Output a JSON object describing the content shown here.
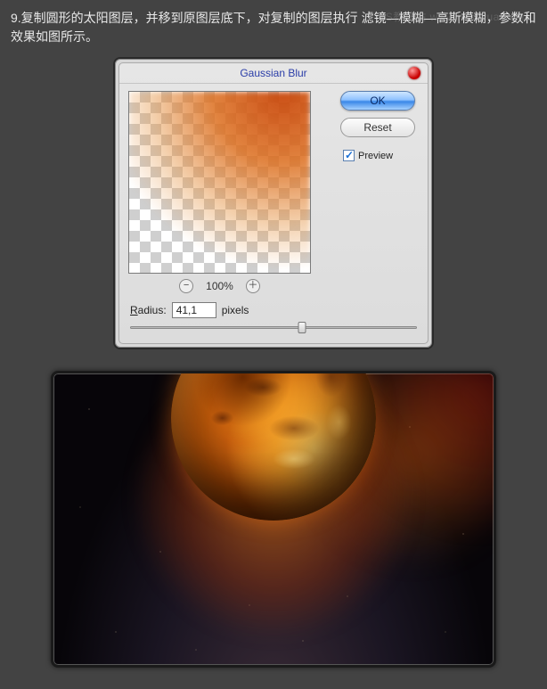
{
  "instruction": {
    "text": "9.复制圆形的太阳图层，并移到原图层底下，对复制的图层执行 滤镜—模糊—高斯模糊，参数和效果如图所示。",
    "watermark": "PS教程站 www.missyuan.com"
  },
  "dialog": {
    "title": "Gaussian Blur",
    "buttons": {
      "ok": "OK",
      "reset": "Reset"
    },
    "preview_checkbox": {
      "label": "Preview",
      "checked": true
    },
    "zoom": {
      "minus": "−",
      "plus": "＋",
      "level": "100%"
    },
    "radius": {
      "label_prefix": "R",
      "label_rest": "adius:",
      "value": "41,1",
      "unit": "pixels",
      "slider_position_pct": 60
    }
  }
}
